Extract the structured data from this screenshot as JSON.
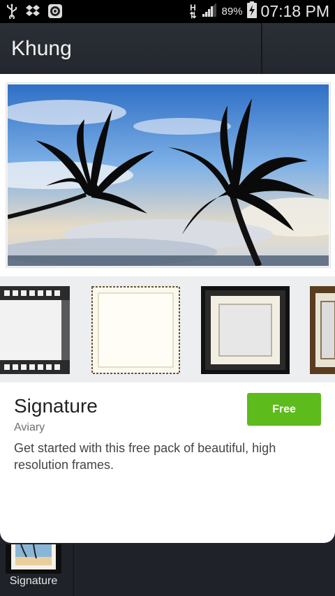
{
  "status_bar": {
    "battery": "89%",
    "time": "07:18 PM",
    "network_letter": "H",
    "icons": [
      "usb-icon",
      "dropbox-icon",
      "camera-app-icon",
      "network-h-icon",
      "signal-icon",
      "battery-charging-icon"
    ]
  },
  "header": {
    "title": "Khung"
  },
  "pack": {
    "title": "Signature",
    "author": "Aviary",
    "description": "Get started with this free pack of beautiful, high resolution frames.",
    "button_label": "Free",
    "button_color": "#5dbb1c"
  },
  "list": {
    "items": [
      {
        "label": "Signature"
      }
    ]
  },
  "frame_previews": [
    "film-strip-frame",
    "vintage-paper-frame",
    "black-matte-frame",
    "wood-frame"
  ]
}
